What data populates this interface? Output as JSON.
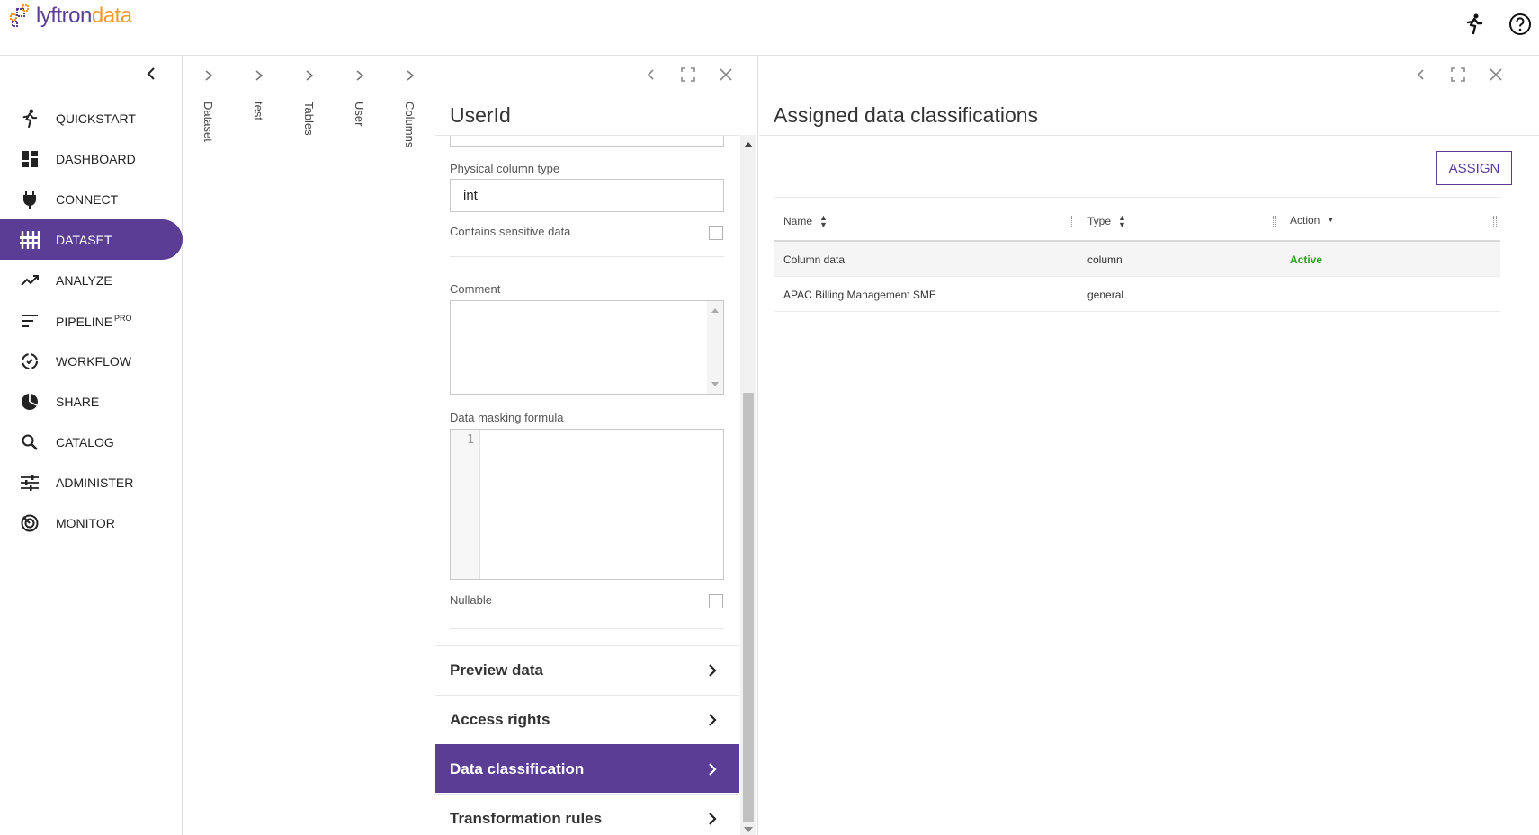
{
  "brand": {
    "name_main": "lyftron",
    "name_accent": "data"
  },
  "header": {
    "quickstart_icon": "running-person-icon",
    "help_icon": "help-circle-icon"
  },
  "sidebar": {
    "items": [
      {
        "label": "QUICKSTART",
        "icon": "running-person-icon"
      },
      {
        "label": "DASHBOARD",
        "icon": "dashboard-icon"
      },
      {
        "label": "CONNECT",
        "icon": "plug-icon"
      },
      {
        "label": "DATASET",
        "icon": "dataset-icon",
        "active": true
      },
      {
        "label": "ANALYZE",
        "icon": "trend-icon"
      },
      {
        "label": "PIPELINE",
        "sup": "PRO",
        "icon": "pipeline-icon"
      },
      {
        "label": "WORKFLOW",
        "icon": "workflow-icon"
      },
      {
        "label": "SHARE",
        "icon": "pie-icon"
      },
      {
        "label": "CATALOG",
        "icon": "search-icon"
      },
      {
        "label": "ADMINISTER",
        "icon": "sliders-icon"
      },
      {
        "label": "MONITOR",
        "icon": "monitor-icon"
      }
    ]
  },
  "breadcrumbs": [
    "Dataset",
    "test",
    "Tables",
    "User",
    "Columns"
  ],
  "column_panel": {
    "title": "UserId",
    "physical_type_label": "Physical column type",
    "physical_type_value": "int",
    "sensitive_label": "Contains sensitive data",
    "comment_label": "Comment",
    "masking_label": "Data masking formula",
    "masking_line_number": "1",
    "nullable_label": "Nullable",
    "sections": [
      {
        "label": "Preview data",
        "active": false
      },
      {
        "label": "Access rights",
        "active": false
      },
      {
        "label": "Data classification",
        "active": true
      },
      {
        "label": "Transformation rules",
        "active": false
      }
    ]
  },
  "classification_panel": {
    "title": "Assigned data classifications",
    "assign_label": "ASSIGN",
    "columns": [
      "Name",
      "Type",
      "Action"
    ],
    "rows": [
      {
        "name": "Column data",
        "type": "column",
        "action": "Active"
      },
      {
        "name": "APAC Billing Management SME",
        "type": "general",
        "action": ""
      }
    ],
    "colors": {
      "active": "#2e9a27",
      "accent": "#5b3d96"
    }
  }
}
